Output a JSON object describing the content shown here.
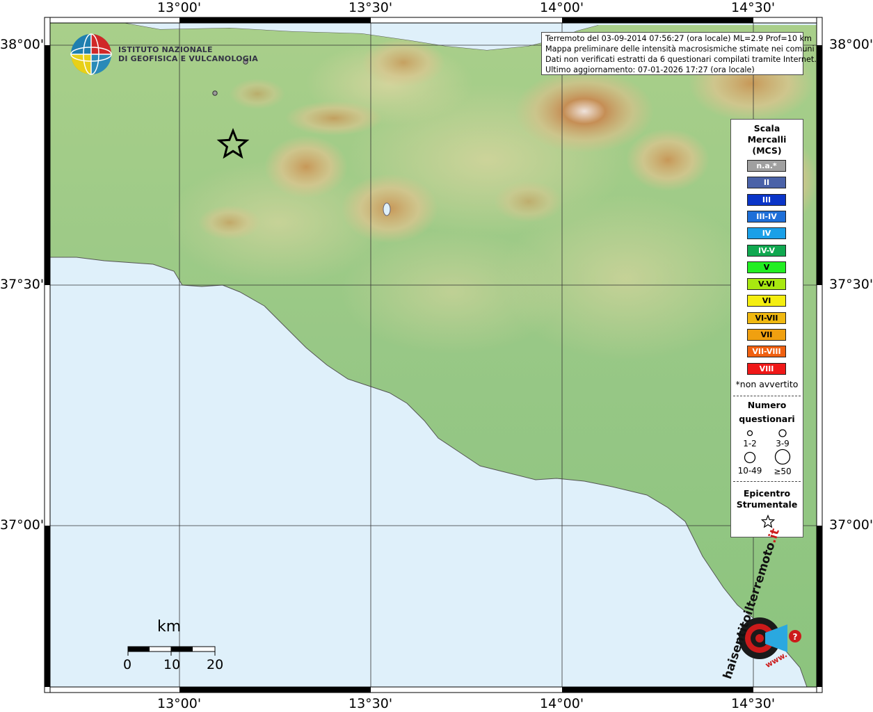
{
  "frame": {
    "lon_ticks": [
      "13°00'",
      "13°30'",
      "14°00'",
      "14°30'"
    ],
    "lat_ticks": [
      "38°00'",
      "37°30'",
      "37°00'"
    ]
  },
  "header": {
    "logo_line1": "ISTITUTO NAZIONALE",
    "logo_line2": "DI GEOFISICA E VULCANOLOGIA"
  },
  "info": {
    "line1": "Terremoto del 03-09-2014 07:56:27 (ora locale) ML=2.9 Prof=10 km",
    "line2": "Mappa preliminare delle intensità macrosismiche stimate nei comuni",
    "line3": "Dati non verificati estratti da 6 questionari compilati tramite Internet.",
    "line4": "Ultimo aggiornamento: 07-01-2026 17:27 (ora locale)"
  },
  "legend": {
    "title_line1": "Scala",
    "title_line2": "Mercalli",
    "title_line3": "(MCS)",
    "intensities": [
      {
        "label": "n.a.*",
        "color": "#a0a0a0"
      },
      {
        "label": "II",
        "color": "#4a62a8"
      },
      {
        "label": "III",
        "color": "#0a35c8"
      },
      {
        "label": "III-IV",
        "color": "#1e6fd8"
      },
      {
        "label": "IV",
        "color": "#1aa0e8"
      },
      {
        "label": "IV-V",
        "color": "#10a850"
      },
      {
        "label": "V",
        "color": "#22ee22"
      },
      {
        "label": "V-VI",
        "color": "#a8e810"
      },
      {
        "label": "VI",
        "color": "#f4ee10"
      },
      {
        "label": "VI-VII",
        "color": "#f0b810"
      },
      {
        "label": "VII",
        "color": "#f0a010"
      },
      {
        "label": "VII-VIII",
        "color": "#f06010"
      },
      {
        "label": "VIII",
        "color": "#f01818"
      }
    ],
    "note": "*non avvertito",
    "count_title_line1": "Numero",
    "count_title_line2": "questionari",
    "count_labels": [
      "1-2",
      "3-9",
      "10-49",
      "≥50"
    ],
    "epicenter_line1": "Epicentro",
    "epicenter_line2": "Strumentale"
  },
  "scale_bar": {
    "unit": "km",
    "labels": [
      "0",
      "10",
      "20"
    ]
  },
  "watermark": {
    "text1": "haisentitoilterremoto",
    "text2": ".it",
    "text3": "www."
  },
  "colors": {
    "sea": "#dff0fa",
    "land_low": "#8fc47e",
    "land_mid": "#c9d9a0",
    "land_high": "#c99a5a",
    "mountain_peak": "#e8dcd8",
    "frame": "#000000",
    "brand_red": "#cc1a1a"
  },
  "epicenter": {
    "lat": "37°43'",
    "lon": "13°08'"
  }
}
